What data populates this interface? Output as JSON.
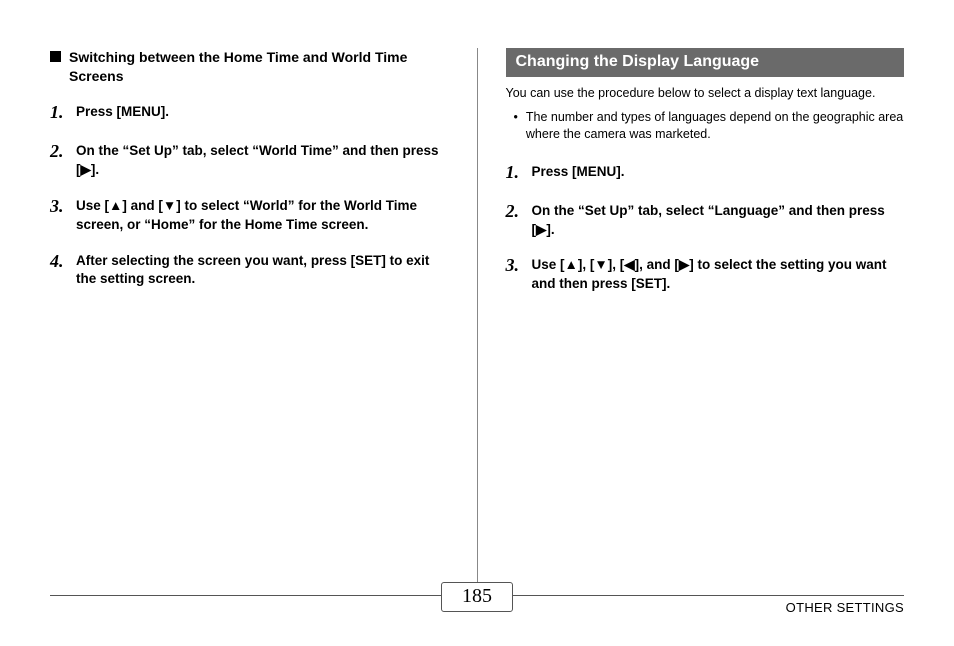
{
  "left": {
    "heading": "Switching between the Home Time and World Time Screens",
    "steps": [
      "Press [MENU].",
      "On the “Set Up” tab, select “World Time” and then press [▶].",
      "Use [▲] and [▼] to select “World” for the World Time screen, or “Home” for the Home Time screen.",
      "After selecting the screen you want, press [SET] to exit the setting screen."
    ]
  },
  "right": {
    "banner": "Changing the Display Language",
    "intro": "You can use the procedure below to select a display text language.",
    "notes": [
      "The number and types of languages depend on the geographic area where the camera was marketed."
    ],
    "steps": [
      "Press [MENU].",
      "On the “Set Up” tab, select “Language” and then press [▶].",
      "Use [▲], [▼], [◀], and [▶] to select the setting you want and then press [SET]."
    ]
  },
  "footer": {
    "page_number": "185",
    "section_label": "OTHER SETTINGS"
  }
}
